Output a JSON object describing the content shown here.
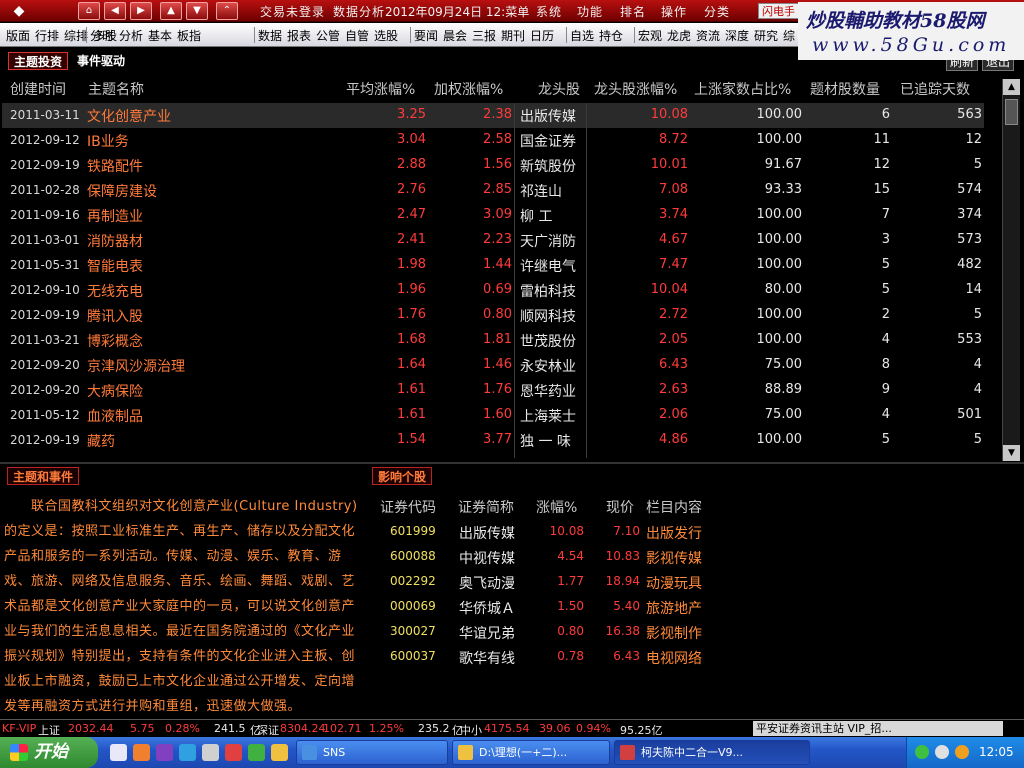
{
  "topbar": {
    "nav_icons": [
      "diamond-logo",
      "home",
      "left-arrow",
      "right-arrow",
      "up-arrow",
      "down-arrow",
      "expand-arrow"
    ],
    "menu": [
      "交易未登录",
      "数据分析",
      "2012年09月24日 12:菜单",
      "系统",
      "功能",
      "排名",
      "操作",
      "分类"
    ],
    "flash_label": "闪电手"
  },
  "watermark": {
    "line1": "炒股輔助教材58股网",
    "line2": "www.58Gu.com"
  },
  "funcbar": {
    "groups": [
      [
        "版面",
        "行排",
        "综排",
        "多股"
      ],
      [
        "分时",
        "分析",
        "基本",
        "板指"
      ],
      [
        "数据",
        "报表",
        "公管",
        "自管",
        "选股"
      ],
      [
        "要闻",
        "晨会",
        "三报",
        "期刊",
        "日历"
      ],
      [
        "自选",
        "持仓"
      ],
      [
        "宏观",
        "龙虎",
        "资流",
        "深度",
        "研究",
        "综"
      ]
    ]
  },
  "tabs": {
    "theme": "主题投资",
    "event": "事件驱动",
    "refresh": "刷新",
    "exit": "退出"
  },
  "table": {
    "headers": [
      "创建时间",
      "主题名称",
      "平均涨幅%",
      "加权涨幅%",
      "龙头股",
      "龙头股涨幅%",
      "上涨家数占比%",
      "题材股数量",
      "已追踪天数"
    ],
    "rows": [
      [
        "2011-03-11",
        "文化创意产业",
        "3.25",
        "2.38",
        "出版传媒",
        "10.08",
        "100.00",
        "6",
        "563"
      ],
      [
        "2012-09-12",
        "IB业务",
        "3.04",
        "2.58",
        "国金证券",
        "8.72",
        "100.00",
        "11",
        "12"
      ],
      [
        "2012-09-19",
        "铁路配件",
        "2.88",
        "1.56",
        "新筑股份",
        "10.01",
        "91.67",
        "12",
        "5"
      ],
      [
        "2011-02-28",
        "保障房建设",
        "2.76",
        "2.85",
        " 祁连山",
        "7.08",
        "93.33",
        "15",
        "574"
      ],
      [
        "2011-09-16",
        "再制造业",
        "2.47",
        "3.09",
        " 柳   工",
        "3.74",
        "100.00",
        "7",
        "374"
      ],
      [
        "2011-03-01",
        "消防器材",
        "2.41",
        "2.23",
        "天广消防",
        "4.67",
        "100.00",
        "3",
        "573"
      ],
      [
        "2011-05-31",
        "智能电表",
        "1.98",
        "1.44",
        "许继电气",
        "7.47",
        "100.00",
        "5",
        "482"
      ],
      [
        "2012-09-10",
        "无线充电",
        "1.96",
        "0.69",
        "雷柏科技",
        "10.04",
        "80.00",
        "5",
        "14"
      ],
      [
        "2012-09-19",
        "腾讯入股",
        "1.76",
        "0.80",
        "顺网科技",
        "2.72",
        "100.00",
        "2",
        "5"
      ],
      [
        "2011-03-21",
        "博彩概念",
        "1.68",
        "1.81",
        "世茂股份",
        "2.05",
        "100.00",
        "4",
        "553"
      ],
      [
        "2012-09-20",
        "京津风沙源治理",
        "1.64",
        "1.46",
        "永安林业",
        "6.43",
        "75.00",
        "8",
        "4"
      ],
      [
        "2012-09-20",
        "大病保险",
        "1.61",
        "1.76",
        "恩华药业",
        "2.63",
        "88.89",
        "9",
        "4"
      ],
      [
        "2011-05-12",
        "血液制品",
        "1.61",
        "1.60",
        "上海莱士",
        "2.06",
        "75.00",
        "4",
        "501"
      ],
      [
        "2012-09-19",
        "藏药",
        "1.54",
        "3.77",
        " 独 一 味",
        "4.86",
        "100.00",
        "5",
        "5"
      ]
    ]
  },
  "lower": {
    "left_tab": "主题和事件",
    "right_tab": "影响个股",
    "description": "　　联合国教科文组织对文化创意产业(Culture Industry)的定义是：按照工业标准生产、再生产、储存以及分配文化产品和服务的一系列活动。传媒、动漫、娱乐、教育、游戏、旅游、网络及信息服务、音乐、绘画、舞蹈、戏剧、艺术品都是文化创意产业大家庭中的一员，可以说文化创意产业与我们的生活息息相关。最近在国务院通过的《文化产业振兴规划》特别提出，支持有条件的文化企业进入主板、创业板上市融资，鼓励已上市文化企业通过公开增发、定向增发等再融资方式进行并购和重组，迅速做大做强。",
    "stock_headers": [
      "证券代码",
      "证券简称",
      "涨幅%",
      "现价",
      "栏目内容"
    ],
    "stocks": [
      [
        "601999",
        "出版传媒",
        "10.08",
        "7.10",
        "出版发行"
      ],
      [
        "600088",
        "中视传媒",
        "4.54",
        "10.83",
        "影视传媒"
      ],
      [
        "002292",
        "奥飞动漫",
        "1.77",
        "18.94",
        "动漫玩具"
      ],
      [
        "000069",
        "华侨城Ａ",
        "1.50",
        "5.40",
        "旅游地产"
      ],
      [
        "300027",
        "华谊兄弟",
        "0.80",
        "16.38",
        "影视制作"
      ],
      [
        "600037",
        "歌华有线",
        "0.78",
        "6.43",
        "电视网络"
      ]
    ]
  },
  "statusbar": {
    "items": [
      {
        "text": "KF-VIP",
        "color": "#ff3b3b"
      },
      {
        "text": "上证",
        "color": "#e8e8e8"
      },
      {
        "text": "2032.44",
        "color": "#ff3b3b"
      },
      {
        "text": "5.75",
        "color": "#ff3b3b"
      },
      {
        "text": "0.28%",
        "color": "#ff3b3b"
      },
      {
        "text": "241.5",
        "color": "#e8e8e8"
      },
      {
        "text": "亿",
        "color": "#e8e8e8"
      },
      {
        "text": "深证",
        "color": "#e8e8e8"
      },
      {
        "text": "8304.24",
        "color": "#ff3b3b"
      },
      {
        "text": "102.71",
        "color": "#ff3b3b"
      },
      {
        "text": "1.25%",
        "color": "#ff3b3b"
      },
      {
        "text": "235.2",
        "color": "#e8e8e8"
      },
      {
        "text": "亿",
        "color": "#e8e8e8"
      },
      {
        "text": "中小",
        "color": "#e8e8e8"
      },
      {
        "text": "4175.54",
        "color": "#ff3b3b"
      },
      {
        "text": "39.06",
        "color": "#ff3b3b"
      },
      {
        "text": "0.94%",
        "color": "#ff3b3b"
      },
      {
        "text": "95.25亿",
        "color": "#e8e8e8"
      }
    ],
    "news": "平安证券资讯主站 VIP_招..."
  },
  "taskbar": {
    "start": "开始",
    "tasks": [
      {
        "label": "SNS",
        "active": false
      },
      {
        "label": "D:\\理想(一+二)...",
        "active": false
      },
      {
        "label": "柯夫陈中二合一V9...",
        "active": true
      }
    ],
    "clock": "12:05"
  },
  "colors": {
    "up_red": "#ff3b3b",
    "theme_orange": "#ff7a3a",
    "tab_border": "#b22222",
    "xp_blue": "#2456c8",
    "start_green": "#3a9a3a"
  }
}
